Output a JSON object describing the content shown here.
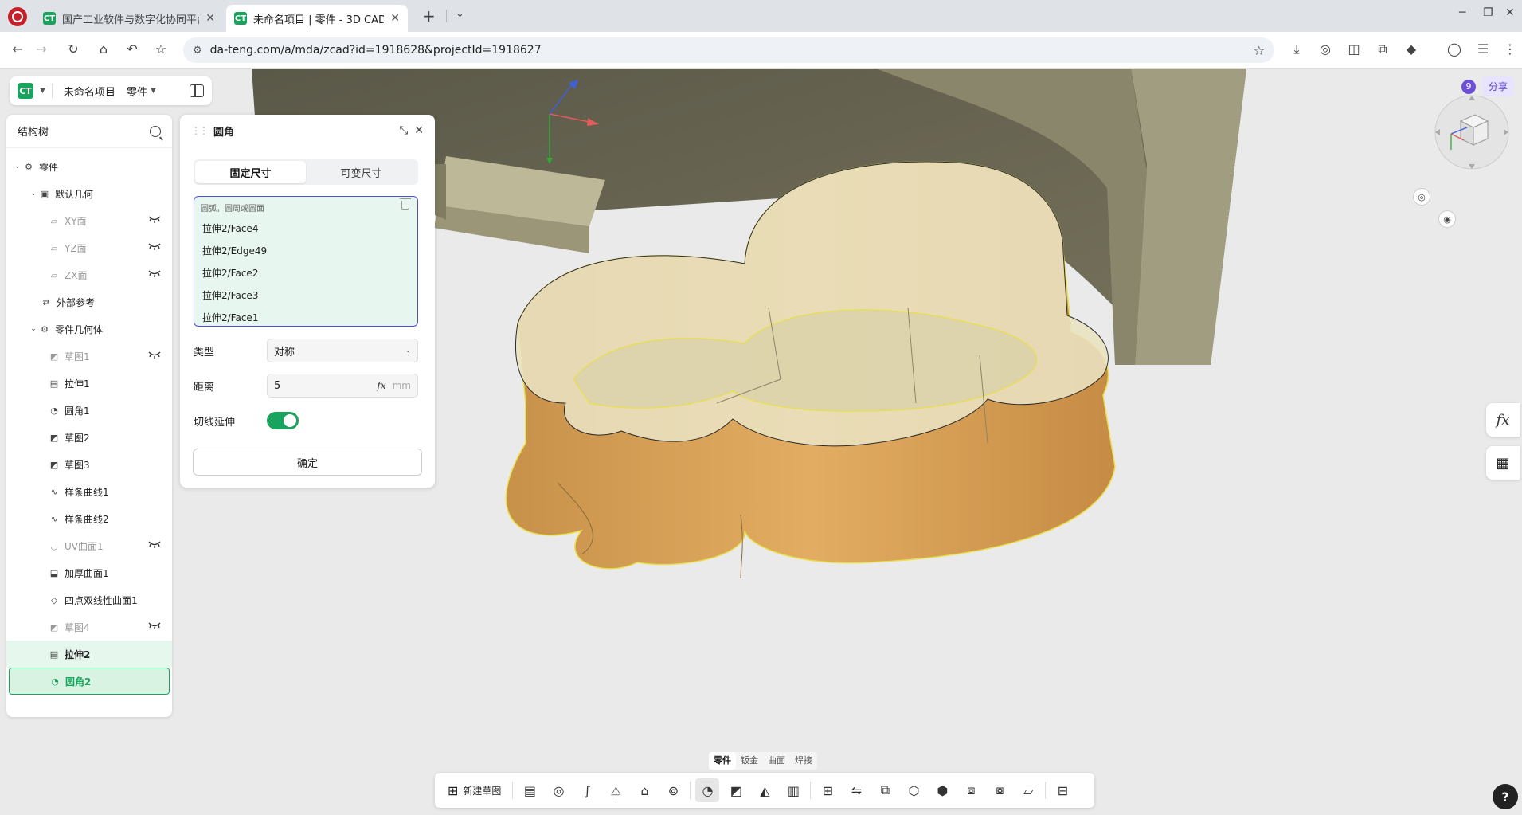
{
  "browser": {
    "tabs": [
      {
        "favicon": "CT",
        "title": "国产工业软件与数字化协同平台"
      },
      {
        "favicon": "CT",
        "title": "未命名项目 | 零件 - 3D CAD"
      }
    ],
    "url": "da-teng.com/a/mda/zcad?id=1918628&projectId=1918627"
  },
  "app": {
    "logo": "CT",
    "project": "未命名项目",
    "mode": "零件",
    "online_count": "9",
    "share": "分享"
  },
  "tree": {
    "title": "结构树",
    "items": [
      {
        "label": "零件",
        "icon": "part-icon"
      },
      {
        "label": "默认几何",
        "icon": "geometry-icon"
      },
      {
        "label": "XY面",
        "icon": "plane-icon"
      },
      {
        "label": "YZ面",
        "icon": "plane-icon"
      },
      {
        "label": "ZX面",
        "icon": "plane-icon"
      },
      {
        "label": "外部参考",
        "icon": "reference-icon"
      },
      {
        "label": "零件几何体",
        "icon": "body-icon"
      },
      {
        "label": "草图1",
        "icon": "sketch-icon"
      },
      {
        "label": "拉伸1",
        "icon": "extrude-icon"
      },
      {
        "label": "圆角1",
        "icon": "fillet-icon"
      },
      {
        "label": "草图2",
        "icon": "sketch-icon"
      },
      {
        "label": "草图3",
        "icon": "sketch-icon"
      },
      {
        "label": "样条曲线1",
        "icon": "spline-icon"
      },
      {
        "label": "样条曲线2",
        "icon": "spline-icon"
      },
      {
        "label": "UV曲面1",
        "icon": "surface-icon"
      },
      {
        "label": "加厚曲面1",
        "icon": "thicken-icon"
      },
      {
        "label": "四点双线性曲面1",
        "icon": "bilinear-surface-icon"
      },
      {
        "label": "草图4",
        "icon": "sketch-icon"
      },
      {
        "label": "拉伸2",
        "icon": "extrude-icon"
      },
      {
        "label": "圆角2",
        "icon": "fillet-icon"
      }
    ]
  },
  "dialog": {
    "title": "圆角",
    "tabs": [
      "固定尺寸",
      "可变尺寸"
    ],
    "selection_hint": "圆弧，圆周或圆面",
    "selection": [
      "拉伸2/Face4",
      "拉伸2/Edge49",
      "拉伸2/Face2",
      "拉伸2/Face3",
      "拉伸2/Face1"
    ],
    "type_label": "类型",
    "type_value": "对称",
    "distance_label": "距离",
    "distance_value": "5",
    "distance_fx": "fx",
    "distance_unit": "mm",
    "tangent_label": "切线延伸",
    "tangent_on": true,
    "ok": "确定"
  },
  "ribbon": {
    "tabs": [
      "零件",
      "钣金",
      "曲面",
      "焊接"
    ],
    "new_sketch": "新建草图"
  },
  "side": {
    "fx": "fx"
  },
  "colors": {
    "accent": "#19a35c",
    "selection_border": "#4c4fd6",
    "model_face": "#d4a55a",
    "highlight_edge": "#e8e04a"
  }
}
